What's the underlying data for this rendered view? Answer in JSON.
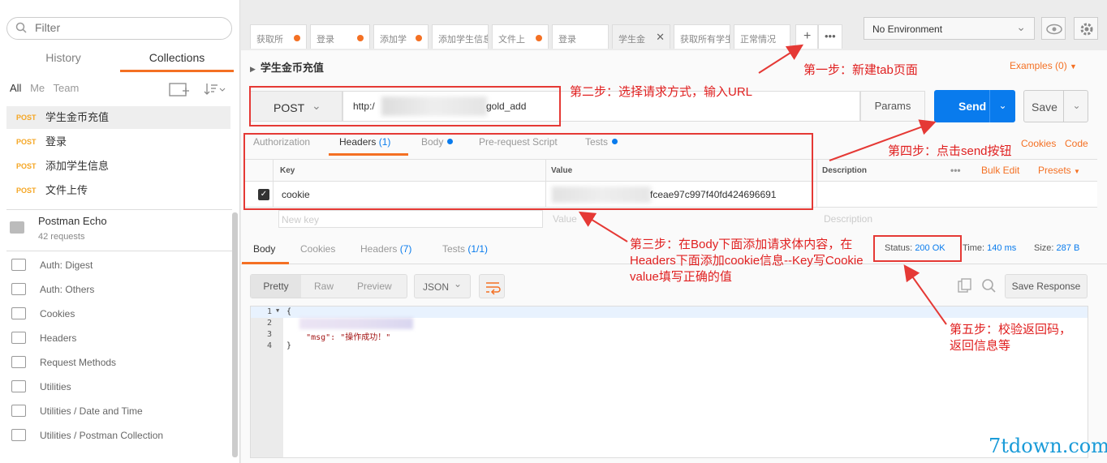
{
  "sidebar": {
    "filter_placeholder": "Filter",
    "tabs": [
      "History",
      "Collections"
    ],
    "scope_filters": [
      "All",
      "Me",
      "Team"
    ],
    "requests": [
      {
        "method": "POST",
        "name": "学生金币充值"
      },
      {
        "method": "POST",
        "name": "登录"
      },
      {
        "method": "POST",
        "name": "添加学生信息"
      },
      {
        "method": "POST",
        "name": "文件上传"
      }
    ],
    "postman_echo": {
      "title": "Postman Echo",
      "subtitle": "42 requests"
    },
    "folders": [
      "Auth: Digest",
      "Auth: Others",
      "Cookies",
      "Headers",
      "Request Methods",
      "Utilities",
      "Utilities / Date and Time",
      "Utilities / Postman Collection"
    ]
  },
  "tabs": [
    "获取所",
    "登录",
    "添加学",
    "添加学生信息",
    "文件上",
    "登录",
    "学生金",
    "获取所有学生",
    "正常情况"
  ],
  "environment": "No Environment",
  "request": {
    "title": "学生金币充值",
    "examples": "Examples (0)",
    "method": "POST",
    "url_prefix": "http:/",
    "url_suffix": "gold_add",
    "params_label": "Params",
    "send_label": "Send",
    "save_label": "Save",
    "tabs": [
      "Authorization",
      "Headers",
      "(1)",
      "Body",
      "Pre-request Script",
      "Tests"
    ],
    "cookies_link": "Cookies",
    "code_link": "Code"
  },
  "headers_table": {
    "columns": [
      "Key",
      "Value",
      "Description"
    ],
    "bulk_edit": "Bulk Edit",
    "presets": "Presets",
    "row": {
      "key": "cookie",
      "value_suffix": "fceae97c997f40fd424696691"
    },
    "new_key_placeholder": "New key",
    "value_placeholder": "Value",
    "description_placeholder": "Description"
  },
  "response": {
    "tabs": [
      "Body",
      "Cookies",
      "Headers",
      "(7)",
      "Tests",
      "(1/1)"
    ],
    "status_label": "Status:",
    "status_value": "200 OK",
    "time_label": "Time:",
    "time_value": "140 ms",
    "size_label": "Size:",
    "size_value": "287 B",
    "view_modes": [
      "Pretty",
      "Raw",
      "Preview"
    ],
    "format": "JSON",
    "save_response": "Save Response",
    "code_lines": [
      "{",
      "",
      "    \"msg\": \"操作成功！\"",
      "}"
    ],
    "line_numbers": [
      "1",
      "2",
      "3",
      "4"
    ]
  },
  "annotations": {
    "step1": "第一步：新建tab页面",
    "step2": "第二步：选择请求方式，输入URL",
    "step3_l1": "第三步：在Body下面添加请求体内容，在",
    "step3_l2": "Headers下面添加cookie信息--Key写Cookie",
    "step3_l3": "value填写正确的值",
    "step4": "第四步：点击send按钮",
    "step5_l1": "第五步：校验返回码，",
    "step5_l2": "返回信息等"
  },
  "watermark": "7tdown.com",
  "colors": {
    "accent": "#f47023",
    "blue": "#097bed",
    "annotation_red": "#e53935"
  }
}
